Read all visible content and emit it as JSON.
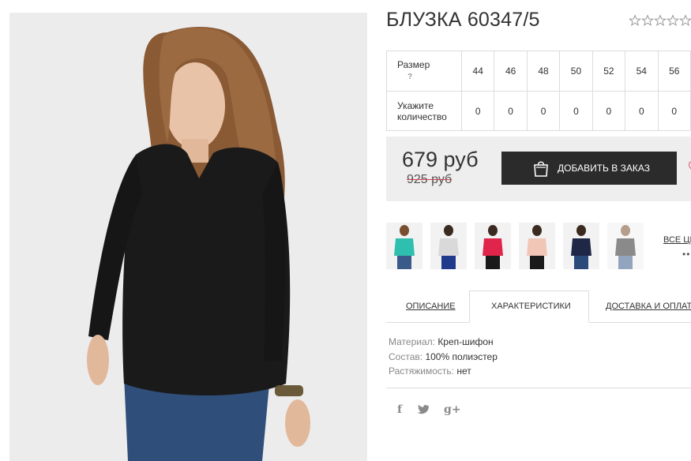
{
  "product": {
    "title": "БЛУЗКА 60347/5",
    "rating_stars": 5
  },
  "size_table": {
    "size_label": "Размер",
    "size_help": "?",
    "qty_label_1": "Укажите",
    "qty_label_2": "количество",
    "sizes": [
      "44",
      "46",
      "48",
      "50",
      "52",
      "54",
      "56"
    ],
    "quantities": [
      "0",
      "0",
      "0",
      "0",
      "0",
      "0",
      "0"
    ]
  },
  "price": {
    "current": "679 руб",
    "old": "925 руб",
    "order_button": "ДОБАВИТЬ В ЗАКАЗ"
  },
  "thumbnails": [
    {
      "color": "#2fbfae",
      "name": "turquoise"
    },
    {
      "color": "#d9d9d9",
      "name": "white"
    },
    {
      "color": "#e0244a",
      "name": "red"
    },
    {
      "color": "#f1c6b7",
      "name": "peach"
    },
    {
      "color": "#1e2746",
      "name": "navy"
    },
    {
      "color": "#2b2b2b",
      "name": "black"
    }
  ],
  "all_colors": {
    "label": "ВСЕ ЦВ",
    "dots": "••"
  },
  "tabs": [
    {
      "label": "ОПИСАНИЕ"
    },
    {
      "label": "ХАРАКТЕРИСТИКИ"
    },
    {
      "label": "ДОСТАВКА И ОПЛАТА"
    }
  ],
  "specs": [
    {
      "key": "Материал:",
      "value": "Креп-шифон"
    },
    {
      "key": "Состав:",
      "value": "100% полиэстер"
    },
    {
      "key": "Растяжимость:",
      "value": "нет"
    }
  ],
  "social": {
    "facebook": "f",
    "twitter": "🐦",
    "gplus": "g+"
  },
  "colors": {
    "button_bg": "#2b2b2b",
    "price_box_bg": "#eeeeee",
    "old_price_strike": "#d0434f",
    "border": "#dcdcdc"
  }
}
